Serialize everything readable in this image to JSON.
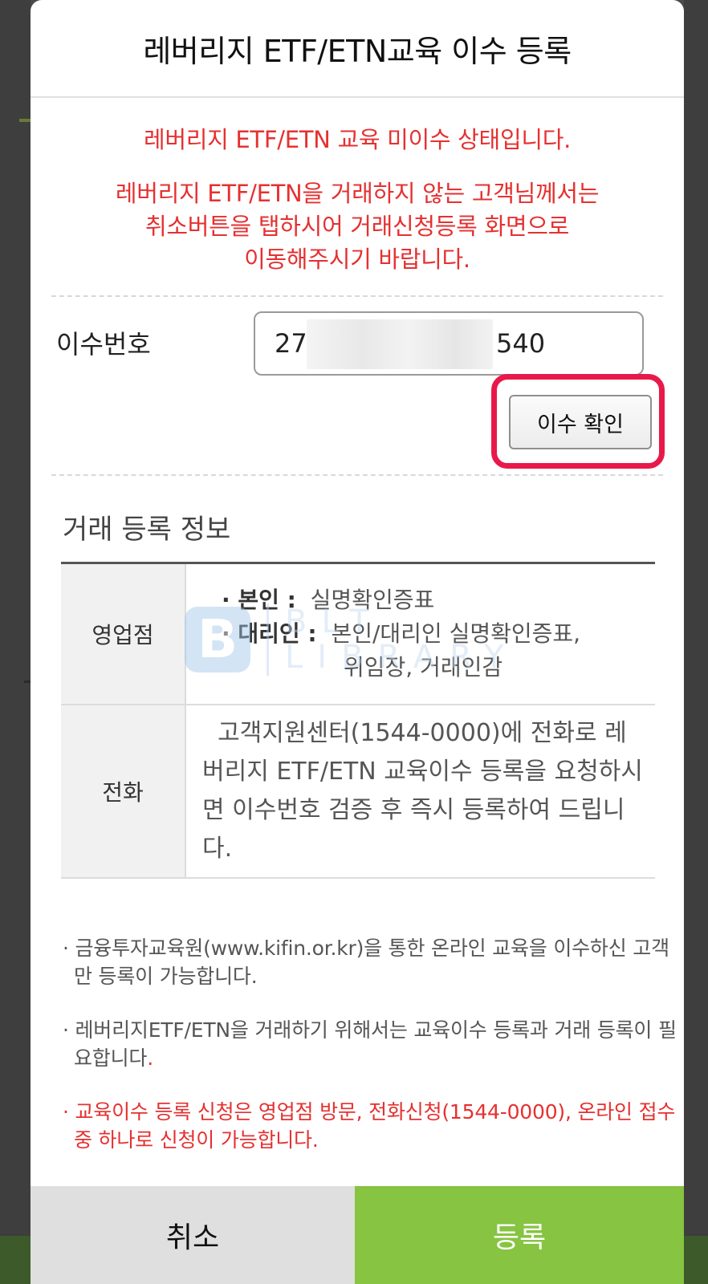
{
  "dialog": {
    "title": "레버리지 ETF/ETN교육 이수 등록",
    "warning_status": "레버리지 ETF/ETN 교육 미이수 상태입니다.",
    "warning_guide": [
      "레버리지 ETF/ETN을 거래하지 않는 고객님께서는",
      "취소버튼을 탭하시어 거래신청등록 화면으로",
      "이동해주시기 바랍니다."
    ]
  },
  "completion": {
    "label": "이수번호",
    "value_visible_start": "278",
    "value_visible_end": "540",
    "confirm_button": "이수 확인"
  },
  "registration": {
    "section_title": "거래 등록 정보",
    "rows": [
      {
        "header": "영업점",
        "items": [
          {
            "bullet": "· 본인 :",
            "text": "실명확인증표"
          },
          {
            "bullet": "· 대리인 :",
            "text": "본인/대리인 실명확인증표,",
            "continuation": "위임장, 거래인감"
          }
        ]
      },
      {
        "header": "전화",
        "text": "고객지원센터(1544-0000)에 전화로 레버리지 ETF/ETN 교육이수 등록을 요청하시면 이수번호 검증 후 즉시 등록하여 드립니다."
      }
    ]
  },
  "watermark": {
    "logo_letter": "B",
    "line1": "BLT",
    "line2": "LIBRARY"
  },
  "notes": [
    "· 금융투자교육원(www.kifin.or.kr)을 통한 온라인 교육을 이수하신 고객만 등록이 가능합니다.",
    "· 레버리지ETF/ETN을 거래하기 위해서는 교육이수 등록과 거래 등록이 필요합니다",
    "· 교육이수 등록 신청은 영업점 방문, 전화신청(1544-0000), 온라인 접수 중 하나로 신청이 가능합니다."
  ],
  "note2_period": ".",
  "buttons": {
    "cancel": "취소",
    "register": "등록"
  },
  "colors": {
    "warning": "#e63030",
    "register_bg": "#86c441",
    "cancel_bg": "#dfdfdf",
    "highlight": "#e8194a"
  }
}
